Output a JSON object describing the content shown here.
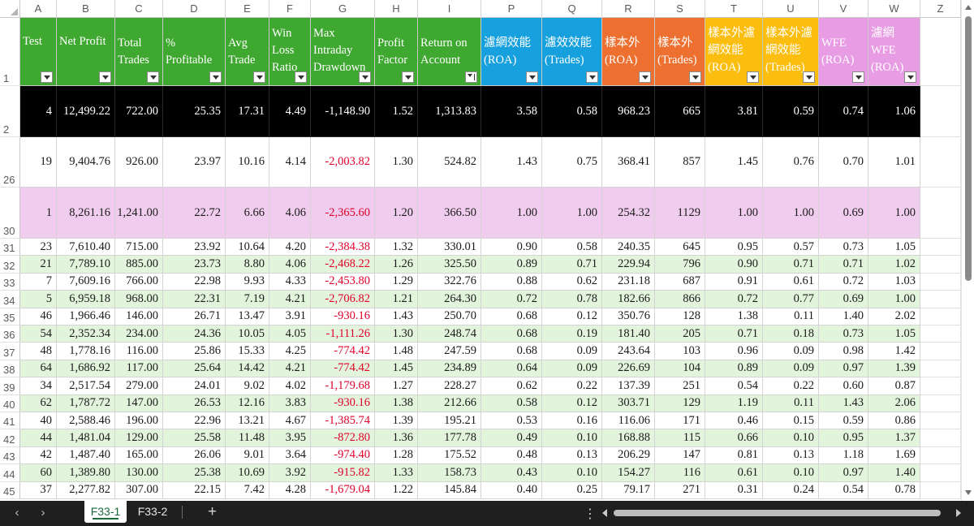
{
  "colors": {
    "green": "#3fa830",
    "blue": "#16a0de",
    "orange": "#ee7030",
    "yellow": "#fbbd0e",
    "pink": "#e89ce4",
    "lightgreen": "#e2f5dc",
    "lightpink": "#f0cdee",
    "black": "#000000",
    "white": "#ffffff",
    "negative": "#e0002a"
  },
  "columns": [
    {
      "letter": "A",
      "header": "Test",
      "color": "green",
      "hstyle": "mid",
      "filter": "filter"
    },
    {
      "letter": "B",
      "header": "Net Profit",
      "color": "green",
      "hstyle": "mid",
      "filter": "filter"
    },
    {
      "letter": "C",
      "header": "Total\nTrades",
      "color": "green",
      "hstyle": "top2",
      "filter": "filter"
    },
    {
      "letter": "D",
      "header": "%\nProfitable",
      "color": "green",
      "hstyle": "top2",
      "filter": "filter"
    },
    {
      "letter": "E",
      "header": "Avg\nTrade",
      "color": "green",
      "hstyle": "top2",
      "filter": "filter"
    },
    {
      "letter": "F",
      "header": "Win\nLoss\nRatio",
      "color": "green",
      "hstyle": "top3",
      "filter": "filter"
    },
    {
      "letter": "G",
      "header": "Max\nIntraday\nDrawdown",
      "color": "green",
      "hstyle": "top3",
      "filter": "filter"
    },
    {
      "letter": "H",
      "header": "Profit\nFactor",
      "color": "green",
      "hstyle": "top2",
      "filter": "filter"
    },
    {
      "letter": "I",
      "header": "Return on\nAccount",
      "color": "green",
      "hstyle": "top2",
      "filter": "sorted"
    },
    {
      "letter": "P",
      "header": "濾網效能\n(ROA)",
      "color": "blue",
      "hstyle": "top2",
      "filter": "filter"
    },
    {
      "letter": "Q",
      "header": "濾效效能\n(Trades)",
      "color": "blue",
      "hstyle": "top2",
      "filter": "filter"
    },
    {
      "letter": "R",
      "header": "樣本外\n(ROA)",
      "color": "orange",
      "hstyle": "top2",
      "filter": "filter"
    },
    {
      "letter": "S",
      "header": "樣本外\n(Trades)",
      "color": "orange",
      "hstyle": "top2",
      "filter": "filter"
    },
    {
      "letter": "T",
      "header": "樣本外濾\n網效能\n(ROA)",
      "color": "yellow",
      "hstyle": "top3",
      "filter": "filter"
    },
    {
      "letter": "U",
      "header": "樣本外濾\n網效能\n(Trades)",
      "color": "yellow",
      "hstyle": "top3",
      "filter": "filter"
    },
    {
      "letter": "V",
      "header": "WFE\n(ROA)",
      "color": "pink",
      "hstyle": "top2",
      "filter": "filter"
    },
    {
      "letter": "W",
      "header": "濾網\nWFE\n(ROA)",
      "color": "pink",
      "hstyle": "top3",
      "filter": "filter"
    },
    {
      "letter": "Z",
      "header": "",
      "color": "white",
      "hstyle": "none",
      "filter": "none"
    }
  ],
  "header_row_number": "1",
  "rows": [
    {
      "rownum": "2",
      "style": "black",
      "cells": [
        "4",
        "12,499.22",
        "722.00",
        "25.35",
        "17.31",
        "4.49",
        "-1,148.90",
        "1.52",
        "1,313.83",
        "3.58",
        "0.58",
        "968.23",
        "665",
        "3.81",
        "0.59",
        "0.74",
        "1.06"
      ]
    },
    {
      "rownum": "26",
      "style": "white",
      "cells": [
        "19",
        "9,404.76",
        "926.00",
        "23.97",
        "10.16",
        "4.14",
        "-2,003.82",
        "1.30",
        "524.82",
        "1.43",
        "0.75",
        "368.41",
        "857",
        "1.45",
        "0.76",
        "0.70",
        "1.01"
      ]
    },
    {
      "rownum": "30",
      "style": "lightpink",
      "cells": [
        "1",
        "8,261.16",
        "1,241.00",
        "22.72",
        "6.66",
        "4.06",
        "-2,365.60",
        "1.20",
        "366.50",
        "1.00",
        "1.00",
        "254.32",
        "1129",
        "1.00",
        "1.00",
        "0.69",
        "1.00"
      ]
    },
    {
      "rownum": "31",
      "style": "white",
      "cells": [
        "23",
        "7,610.40",
        "715.00",
        "23.92",
        "10.64",
        "4.20",
        "-2,384.38",
        "1.32",
        "330.01",
        "0.90",
        "0.58",
        "240.35",
        "645",
        "0.95",
        "0.57",
        "0.73",
        "1.05"
      ]
    },
    {
      "rownum": "32",
      "style": "lightgreen",
      "cells": [
        "21",
        "7,789.10",
        "885.00",
        "23.73",
        "8.80",
        "4.06",
        "-2,468.22",
        "1.26",
        "325.50",
        "0.89",
        "0.71",
        "229.94",
        "796",
        "0.90",
        "0.71",
        "0.71",
        "1.02"
      ]
    },
    {
      "rownum": "33",
      "style": "white",
      "cells": [
        "7",
        "7,609.16",
        "766.00",
        "22.98",
        "9.93",
        "4.33",
        "-2,453.80",
        "1.29",
        "322.76",
        "0.88",
        "0.62",
        "231.18",
        "687",
        "0.91",
        "0.61",
        "0.72",
        "1.03"
      ]
    },
    {
      "rownum": "34",
      "style": "lightgreen",
      "cells": [
        "5",
        "6,959.18",
        "968.00",
        "22.31",
        "7.19",
        "4.21",
        "-2,706.82",
        "1.21",
        "264.30",
        "0.72",
        "0.78",
        "182.66",
        "866",
        "0.72",
        "0.77",
        "0.69",
        "1.00"
      ]
    },
    {
      "rownum": "35",
      "style": "white",
      "cells": [
        "46",
        "1,966.46",
        "146.00",
        "26.71",
        "13.47",
        "3.91",
        "-930.16",
        "1.43",
        "250.70",
        "0.68",
        "0.12",
        "350.76",
        "128",
        "1.38",
        "0.11",
        "1.40",
        "2.02"
      ]
    },
    {
      "rownum": "36",
      "style": "lightgreen",
      "cells": [
        "54",
        "2,352.34",
        "234.00",
        "24.36",
        "10.05",
        "4.05",
        "-1,111.26",
        "1.30",
        "248.74",
        "0.68",
        "0.19",
        "181.40",
        "205",
        "0.71",
        "0.18",
        "0.73",
        "1.05"
      ]
    },
    {
      "rownum": "37",
      "style": "white",
      "cells": [
        "48",
        "1,778.16",
        "116.00",
        "25.86",
        "15.33",
        "4.25",
        "-774.42",
        "1.48",
        "247.59",
        "0.68",
        "0.09",
        "243.64",
        "103",
        "0.96",
        "0.09",
        "0.98",
        "1.42"
      ]
    },
    {
      "rownum": "38",
      "style": "lightgreen",
      "cells": [
        "64",
        "1,686.92",
        "117.00",
        "25.64",
        "14.42",
        "4.21",
        "-774.42",
        "1.45",
        "234.89",
        "0.64",
        "0.09",
        "226.69",
        "104",
        "0.89",
        "0.09",
        "0.97",
        "1.39"
      ]
    },
    {
      "rownum": "39",
      "style": "white",
      "cells": [
        "34",
        "2,517.54",
        "279.00",
        "24.01",
        "9.02",
        "4.02",
        "-1,179.68",
        "1.27",
        "228.27",
        "0.62",
        "0.22",
        "137.39",
        "251",
        "0.54",
        "0.22",
        "0.60",
        "0.87"
      ]
    },
    {
      "rownum": "40",
      "style": "lightgreen",
      "cells": [
        "62",
        "1,787.72",
        "147.00",
        "26.53",
        "12.16",
        "3.83",
        "-930.16",
        "1.38",
        "212.66",
        "0.58",
        "0.12",
        "303.71",
        "129",
        "1.19",
        "0.11",
        "1.43",
        "2.06"
      ]
    },
    {
      "rownum": "41",
      "style": "white",
      "cells": [
        "40",
        "2,588.46",
        "196.00",
        "22.96",
        "13.21",
        "4.67",
        "-1,385.74",
        "1.39",
        "195.21",
        "0.53",
        "0.16",
        "116.06",
        "171",
        "0.46",
        "0.15",
        "0.59",
        "0.86"
      ]
    },
    {
      "rownum": "42",
      "style": "lightgreen",
      "cells": [
        "44",
        "1,481.04",
        "129.00",
        "25.58",
        "11.48",
        "3.95",
        "-872.80",
        "1.36",
        "177.78",
        "0.49",
        "0.10",
        "168.88",
        "115",
        "0.66",
        "0.10",
        "0.95",
        "1.37"
      ]
    },
    {
      "rownum": "43",
      "style": "white",
      "cells": [
        "42",
        "1,487.40",
        "165.00",
        "26.06",
        "9.01",
        "3.64",
        "-974.40",
        "1.28",
        "175.52",
        "0.48",
        "0.13",
        "206.29",
        "147",
        "0.81",
        "0.13",
        "1.18",
        "1.69"
      ]
    },
    {
      "rownum": "44",
      "style": "lightgreen",
      "cells": [
        "60",
        "1,389.80",
        "130.00",
        "25.38",
        "10.69",
        "3.92",
        "-915.82",
        "1.33",
        "158.73",
        "0.43",
        "0.10",
        "154.27",
        "116",
        "0.61",
        "0.10",
        "0.97",
        "1.40"
      ]
    },
    {
      "rownum": "45",
      "style": "white",
      "cells": [
        "37",
        "2,277.82",
        "307.00",
        "22.15",
        "7.42",
        "4.28",
        "-1,679.04",
        "1.22",
        "145.84",
        "0.40",
        "0.25",
        "79.17",
        "271",
        "0.31",
        "0.24",
        "0.54",
        "0.78"
      ]
    }
  ],
  "sheet_tabs": [
    {
      "label": "F33-1",
      "active": true
    },
    {
      "label": "F33-2",
      "active": false
    }
  ],
  "icons": {
    "nav_prev": "chevron-left-icon",
    "nav_next": "chevron-right-icon",
    "add_sheet": "plus-icon",
    "more": "kebab-icon"
  }
}
